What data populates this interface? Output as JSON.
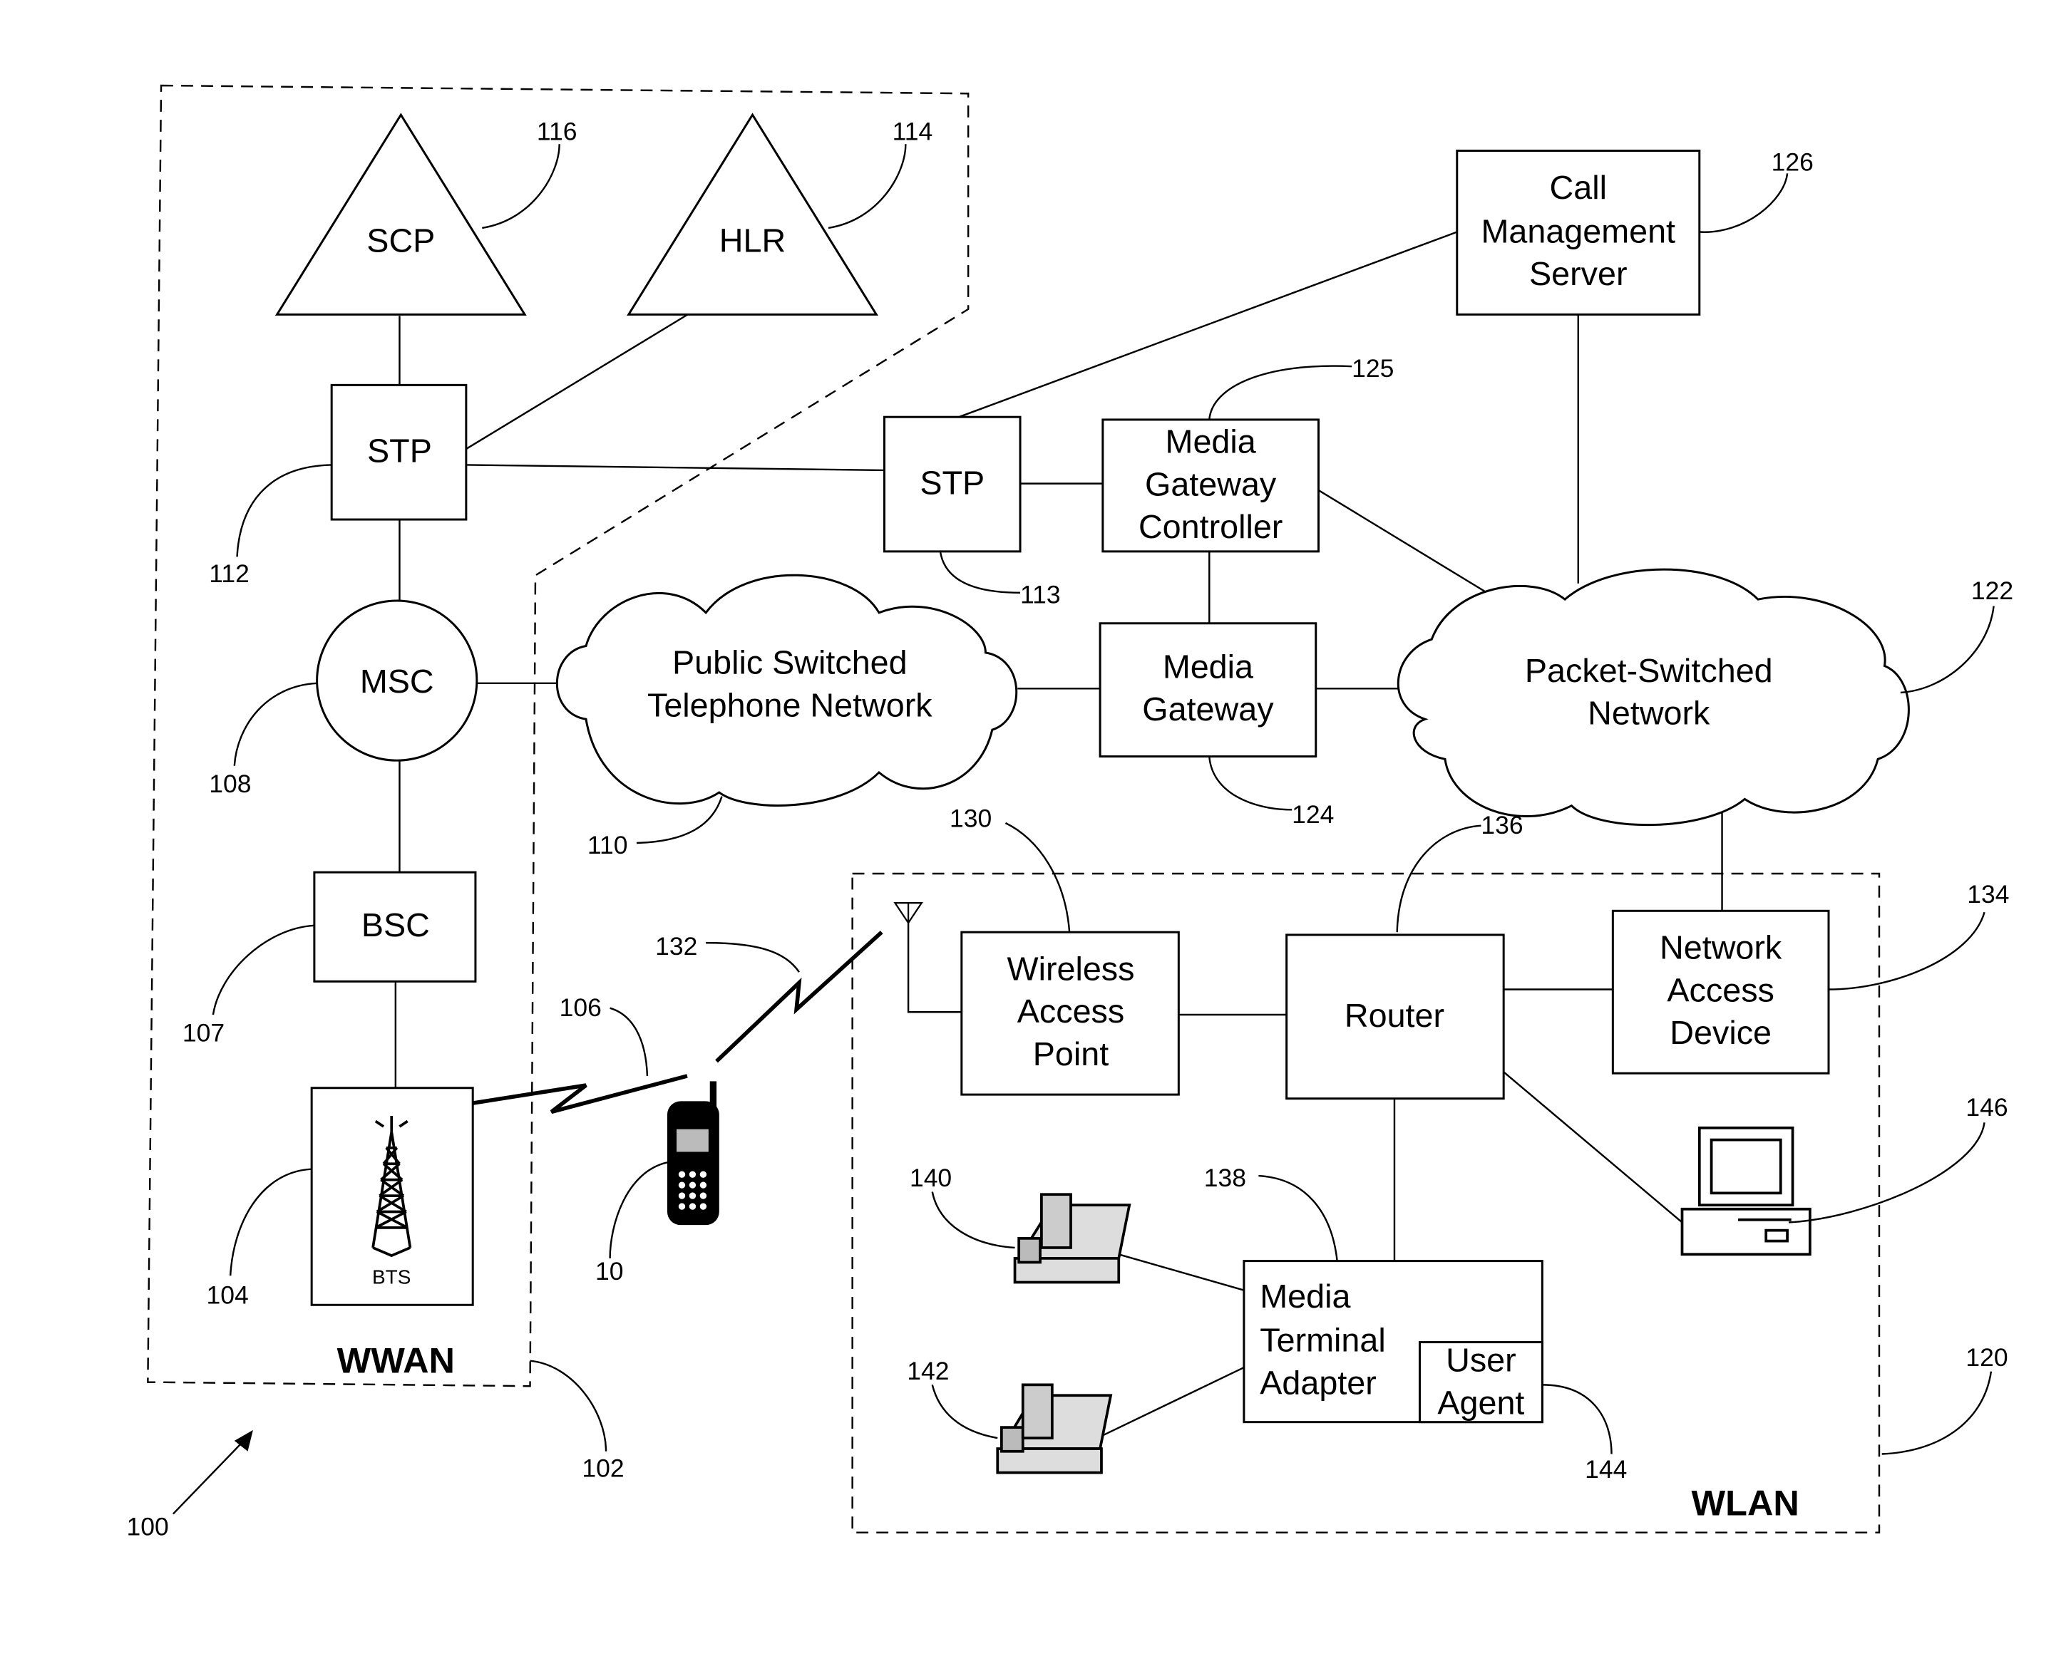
{
  "figure": {
    "ref": "100"
  },
  "regions": {
    "wwan": {
      "label": "WWAN",
      "ref": "102"
    },
    "wlan": {
      "label": "WLAN",
      "ref": "120"
    }
  },
  "nodes": {
    "scp": {
      "label": "SCP",
      "ref": "116"
    },
    "hlr": {
      "label": "HLR",
      "ref": "114"
    },
    "stp1": {
      "label": "STP",
      "ref": "112"
    },
    "msc": {
      "label": "MSC",
      "ref": "108"
    },
    "bsc": {
      "label": "BSC",
      "ref": "107"
    },
    "bts": {
      "label": "BTS",
      "ref": "104"
    },
    "pstn": {
      "lines": [
        "Public Switched",
        "Telephone Network"
      ],
      "ref": "110"
    },
    "stp2": {
      "label": "STP",
      "ref": "113"
    },
    "mgc": {
      "lines": [
        "Media",
        "Gateway",
        "Controller"
      ],
      "ref": "125"
    },
    "mg": {
      "lines": [
        "Media",
        "Gateway"
      ],
      "ref": "124"
    },
    "cms": {
      "lines": [
        "Call",
        "Management",
        "Server"
      ],
      "ref": "126"
    },
    "psn": {
      "lines": [
        "Packet-Switched",
        "Network"
      ],
      "ref": "122"
    },
    "wap": {
      "lines": [
        "Wireless",
        "Access",
        "Point"
      ],
      "ref": "130"
    },
    "router": {
      "label": "Router",
      "ref": "136"
    },
    "nad": {
      "lines": [
        "Network",
        "Access",
        "Device"
      ],
      "ref": "134"
    },
    "mta": {
      "lines": [
        "Media",
        "Terminal",
        "Adapter"
      ],
      "ref": "138"
    },
    "ua": {
      "lines": [
        "User",
        "Agent"
      ],
      "ref": "144"
    },
    "phone1": {
      "ref": "140"
    },
    "phone2": {
      "ref": "142"
    },
    "computer": {
      "ref": "146"
    },
    "mobile": {
      "ref": "10"
    },
    "wwan_link": {
      "ref": "106"
    },
    "wlan_link": {
      "ref": "132"
    }
  }
}
